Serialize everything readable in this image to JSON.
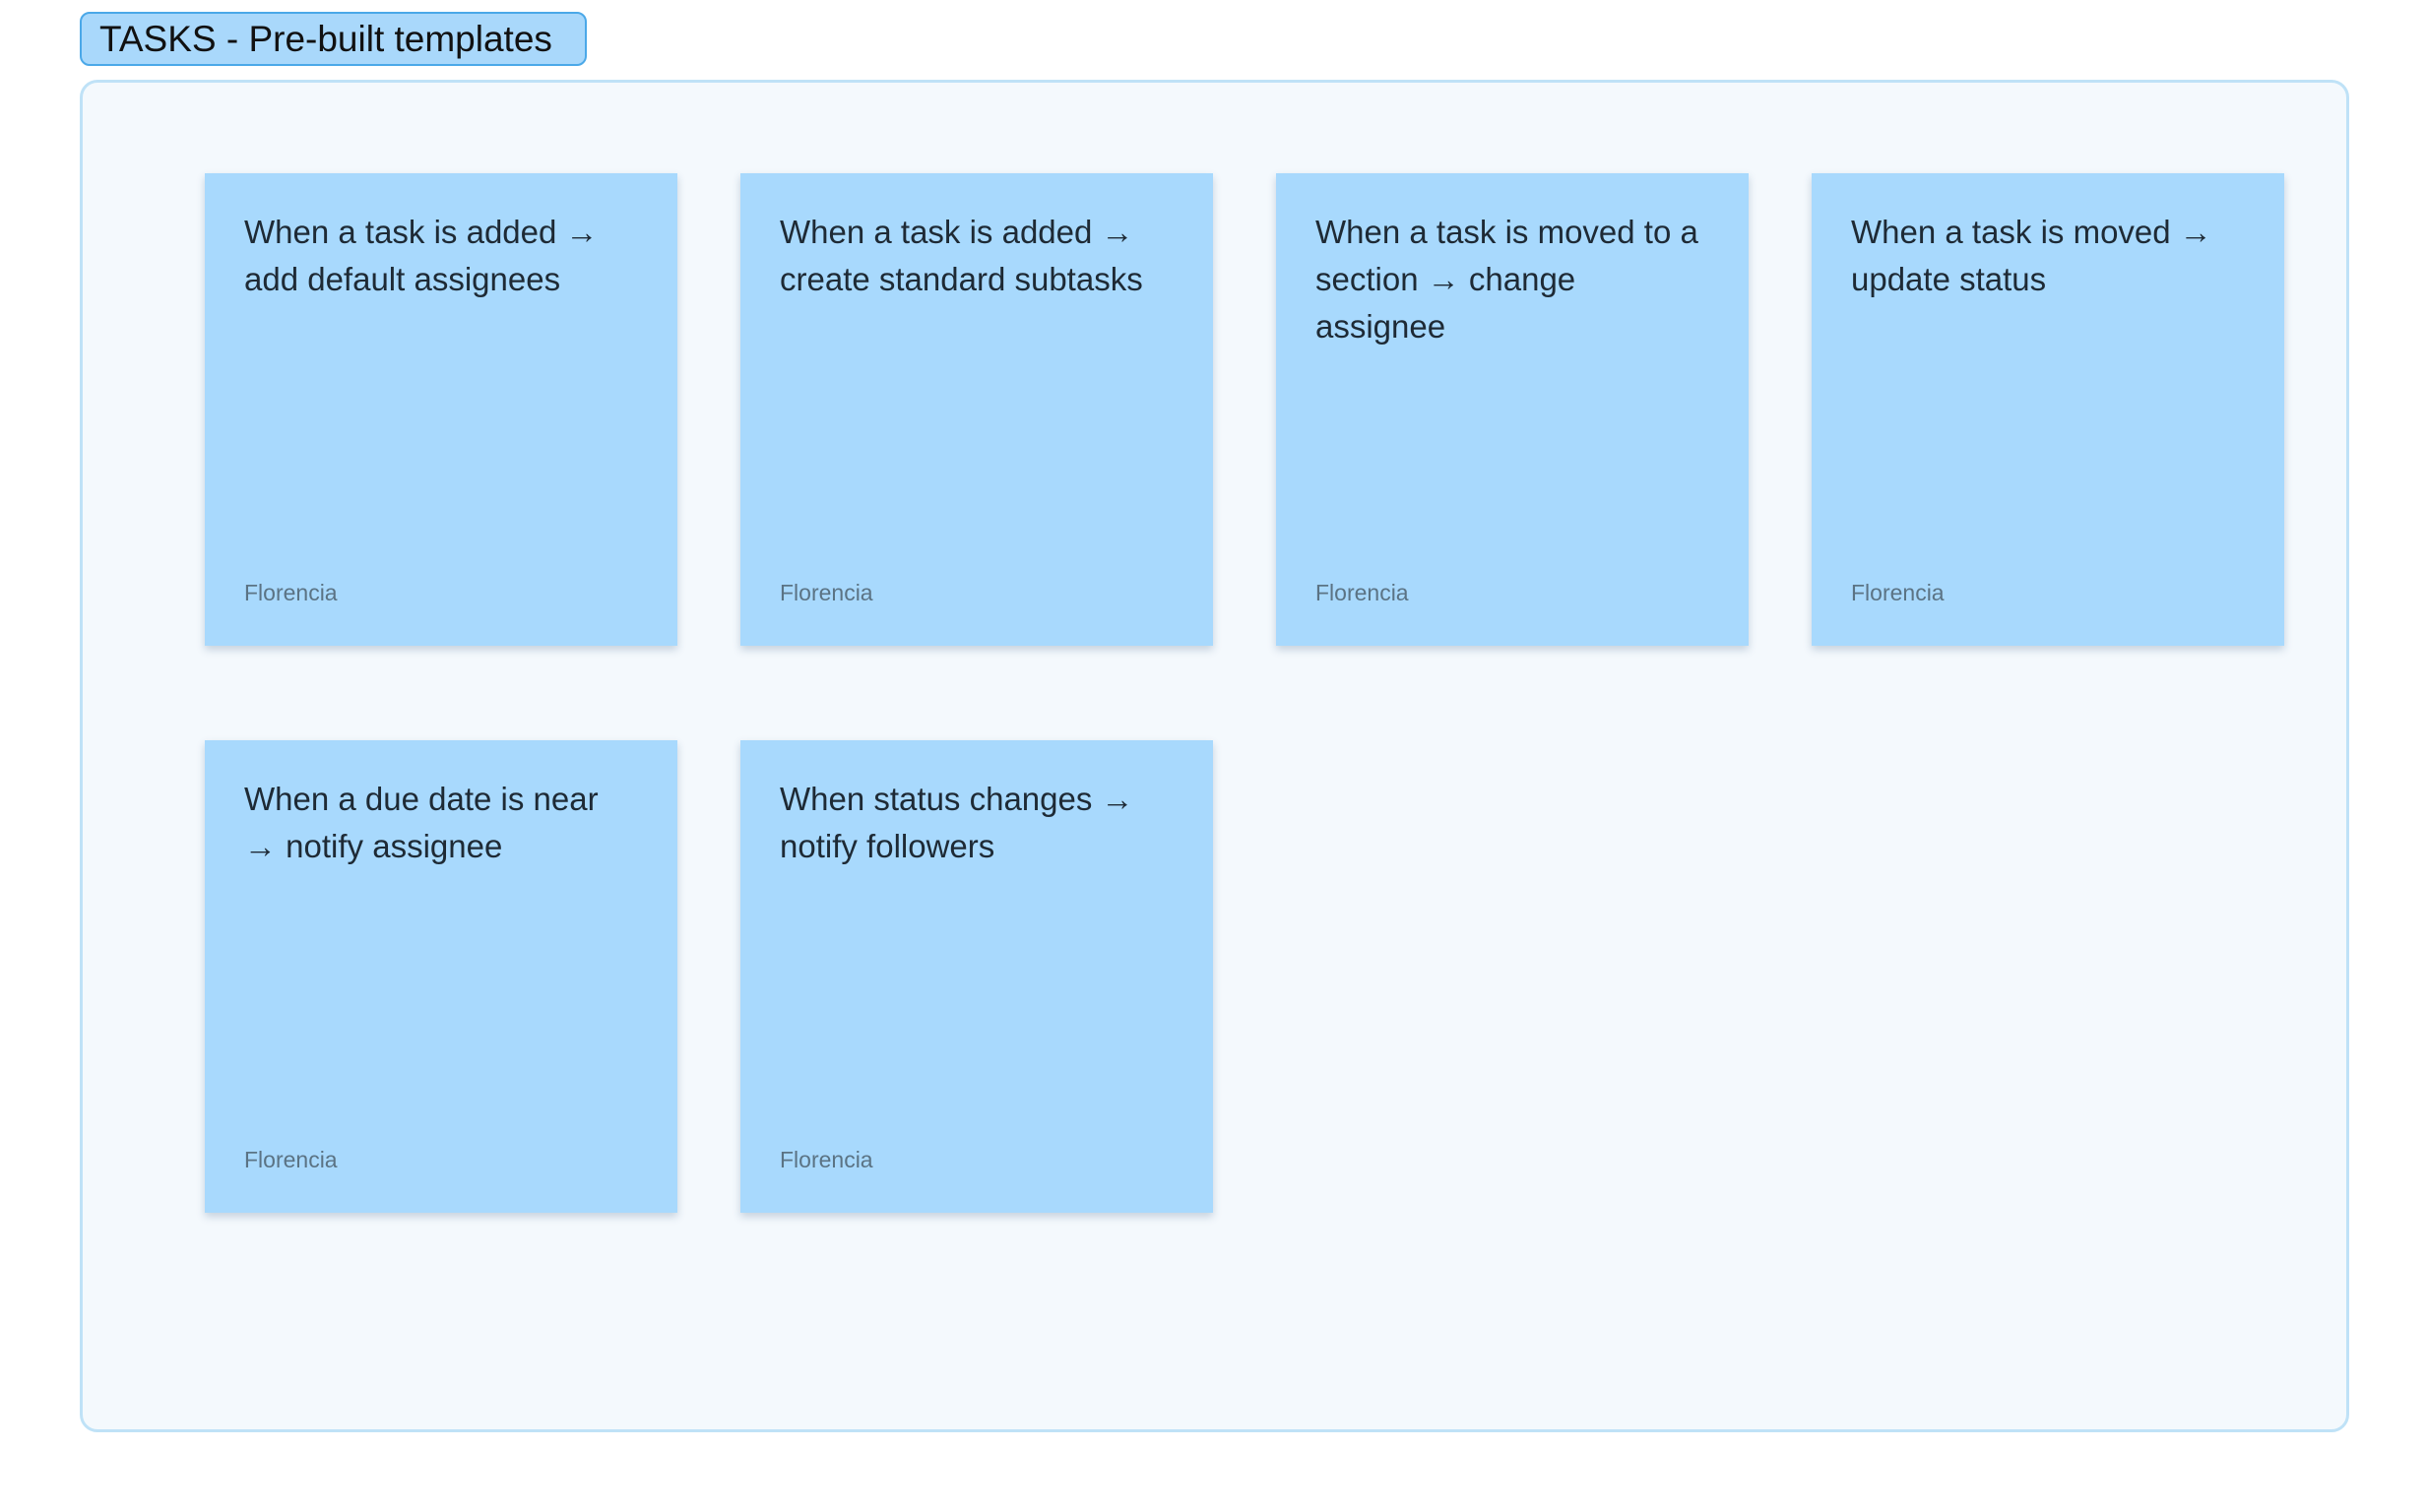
{
  "section": {
    "title": "TASKS - Pre-built templates"
  },
  "stickies": [
    {
      "text": "When a task is added → add default assignees",
      "author": "Florencia"
    },
    {
      "text": "When a task is added → create standard subtasks",
      "author": "Florencia"
    },
    {
      "text": "When a task is moved to a section → change assignee",
      "author": "Florencia"
    },
    {
      "text": "When a task is moved → update status",
      "author": "Florencia"
    },
    {
      "text": "When a due date is near → notify assignee",
      "author": "Florencia"
    },
    {
      "text": "When status changes → notify followers",
      "author": "Florencia"
    }
  ],
  "colors": {
    "sticky": "#a8d9fd",
    "frame_bg": "#f4f9fd",
    "frame_border": "#bfe2f7",
    "label_bg": "#a9d8fb",
    "label_border": "#4ba8e8"
  }
}
